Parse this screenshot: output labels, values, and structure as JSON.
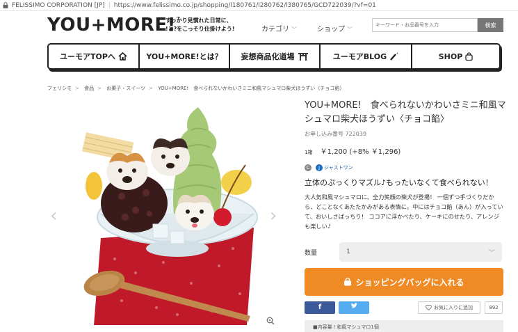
{
  "browser": {
    "site_name": "FELISSIMO CORPORATION [JP]",
    "url": "https://www.felissimo.co.jp/shopping/l180761/l280762/l380765/GCD722039/?vf=01"
  },
  "header": {
    "logo": "YOU+MORE!",
    "logo_tm": "™",
    "tagline_line1": "すっかり見慣れた日常に、",
    "tagline_line2": "!と?をこっそり仕掛けよう!",
    "nav_category": "カテゴリ",
    "nav_shop": "ショップ",
    "search_placeholder": "キーワード・お品番号を入力",
    "search_button": "検索"
  },
  "menu": {
    "items": [
      {
        "label": "ユーモアTOPへ"
      },
      {
        "label": "YOU+MORE!とは？"
      },
      {
        "label": "妄想商品化道場"
      },
      {
        "label": "ユーモアBLOG"
      },
      {
        "label": "SHOP"
      }
    ]
  },
  "breadcrumb": [
    "フェリシモ",
    "食品",
    "お菓子・スイーツ",
    "YOU+MORE!　食べられないかわいさミニ和風マシュマロ柴犬ほうずい〈チョコ餡〉"
  ],
  "product": {
    "title": "YOU+MORE!　食べられないかわいさミニ和風マシュマロ柴犬ほうずい〈チョコ餡〉",
    "order_no_label": "お申し込み番号 722039",
    "unit": "1箱",
    "price": "￥1,200",
    "tax_price": "(+8% ￥1,296)",
    "badge_c": "C",
    "badge_j": "J",
    "badge_label": "ジャストワン",
    "catchphrase": "立体のぷっくりマズル♪もったいなくて食べられない！",
    "description": "大人気和風マシュマロに、全力笑顔の柴犬が登場！ 一個ずつ手づくりだから、どことなくあたたかみがある表情に。中にはチョコ餡（あん）が入っていて、おいしさばっちり！ ココアに浮かべたり、ケーキにのせたり、アレンジも楽しい♪"
  },
  "purchase": {
    "qty_label": "数量",
    "qty_value": "1",
    "cart_button": "ショッピングバッグに入れる",
    "facebook": "f",
    "twitter": "t",
    "favorite_button": "お気に入りに追加",
    "favorite_count": "892",
    "details_snippet": "■内容量 / 和風マシュマロ1個"
  },
  "colors": {
    "accent_orange": "#f08a24",
    "facebook_blue": "#3b5998",
    "twitter_blue": "#55acee"
  }
}
